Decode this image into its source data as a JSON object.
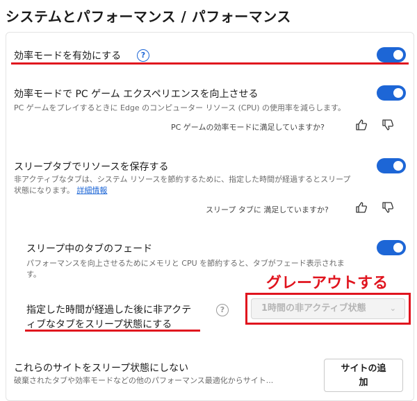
{
  "page": {
    "title": "システムとパフォーマンス / パフォーマンス"
  },
  "efficiency_mode": {
    "label": "効率モードを有効にする",
    "help": "?",
    "enabled": true
  },
  "pc_game": {
    "label": "効率モードで PC ゲーム エクスペリエンスを向上させる",
    "description": "PC ゲームをプレイするときに Edge のコンピューター リソース (CPU) の使用率を減らします。",
    "feedback": "PC ゲームの効率モードに満足していますか?",
    "enabled": true
  },
  "sleeping_tabs": {
    "label": "スリープタブでリソースを保存する",
    "description_line1": "非アクティブなタブは、システム リソースを節約するために、指定した時間が経過するとスリープ",
    "description_line2": "状態になります。",
    "link": "詳細情報",
    "feedback": "スリープ タブに 満足していますか?",
    "enabled": true
  },
  "fade": {
    "label": "スリープ中のタブのフェード",
    "description_line1": "パフォーマンスを向上させるためにメモリと CPU を節約すると、タブがフェード表示されま",
    "description_line2": "す。",
    "enabled": true
  },
  "inactive_timer": {
    "label_line1": "指定した時間が経過した後に非アクテ",
    "label_line2": "ィブなタブをスリープ状態にする",
    "help": "?",
    "selected": "1時間の非アクティブ状態"
  },
  "annotation": {
    "text": "グレーアウトする",
    "color": "#e0141e"
  },
  "never_sleep": {
    "label": "これらのサイトをスリープ状態にしない",
    "description": "破棄されたタブや効率モードなどの他のパフォーマンス最適化からサイト...",
    "button_line1": "サイトの追",
    "button_line2": "加"
  },
  "colors": {
    "accent": "#1d66d6",
    "annotation_red": "#e0141e"
  }
}
